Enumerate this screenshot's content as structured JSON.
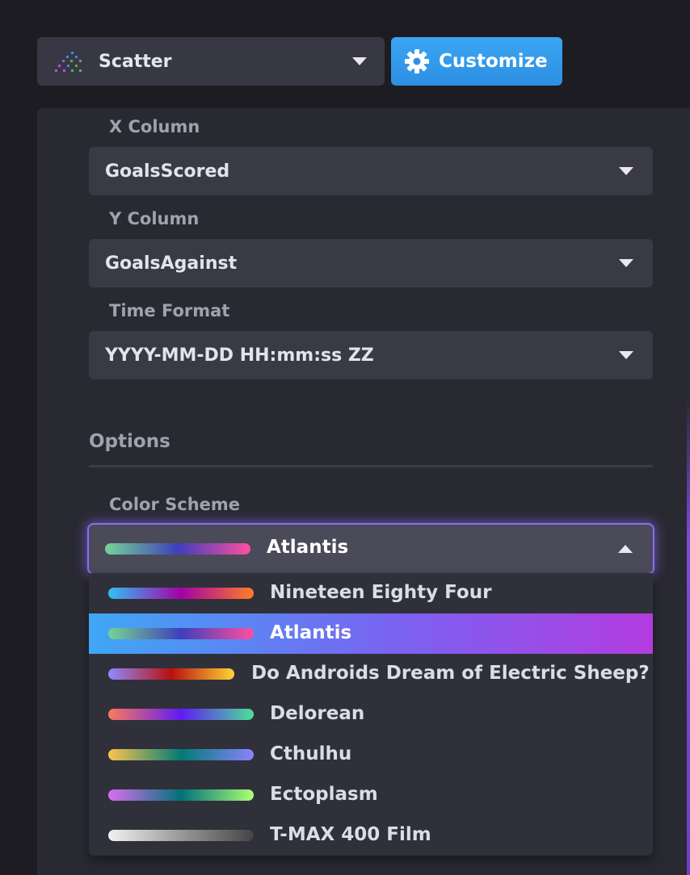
{
  "chart_type": {
    "label": "Scatter",
    "icon": "scatter-plot-icon"
  },
  "customize_button": {
    "label": "Customize",
    "icon": "gear-icon"
  },
  "fields": {
    "x_column": {
      "label": "X Column",
      "value": "GoalsScored"
    },
    "y_column": {
      "label": "Y Column",
      "value": "GoalsAgainst"
    },
    "time_format": {
      "label": "Time Format",
      "value": "YYYY-MM-DD HH:mm:ss ZZ"
    }
  },
  "options": {
    "title": "Options",
    "color_scheme": {
      "label": "Color Scheme",
      "selected": "Atlantis",
      "items": [
        {
          "label": "Nineteen Eighty Four",
          "colors": [
            "#31c0f6",
            "#a500a5",
            "#ff7e27"
          ]
        },
        {
          "label": "Atlantis",
          "colors": [
            "#74d495",
            "#3f3fba",
            "#ff4fa0"
          ]
        },
        {
          "label": "Do Androids Dream of Electric Sheep?",
          "colors": [
            "#8f8aff",
            "#b8100f",
            "#fdd636"
          ]
        },
        {
          "label": "Delorean",
          "colors": [
            "#fd7a5d",
            "#5f1cf2",
            "#4ce09a"
          ]
        },
        {
          "label": "Cthulhu",
          "colors": [
            "#fdc44f",
            "#007c76",
            "#8983ff"
          ]
        },
        {
          "label": "Ectoplasm",
          "colors": [
            "#da6ff1",
            "#00717a",
            "#acff76"
          ]
        },
        {
          "label": "T-MAX 400 Film",
          "colors": [
            "#f1f1f1",
            "#999999",
            "#444444"
          ]
        }
      ]
    }
  }
}
